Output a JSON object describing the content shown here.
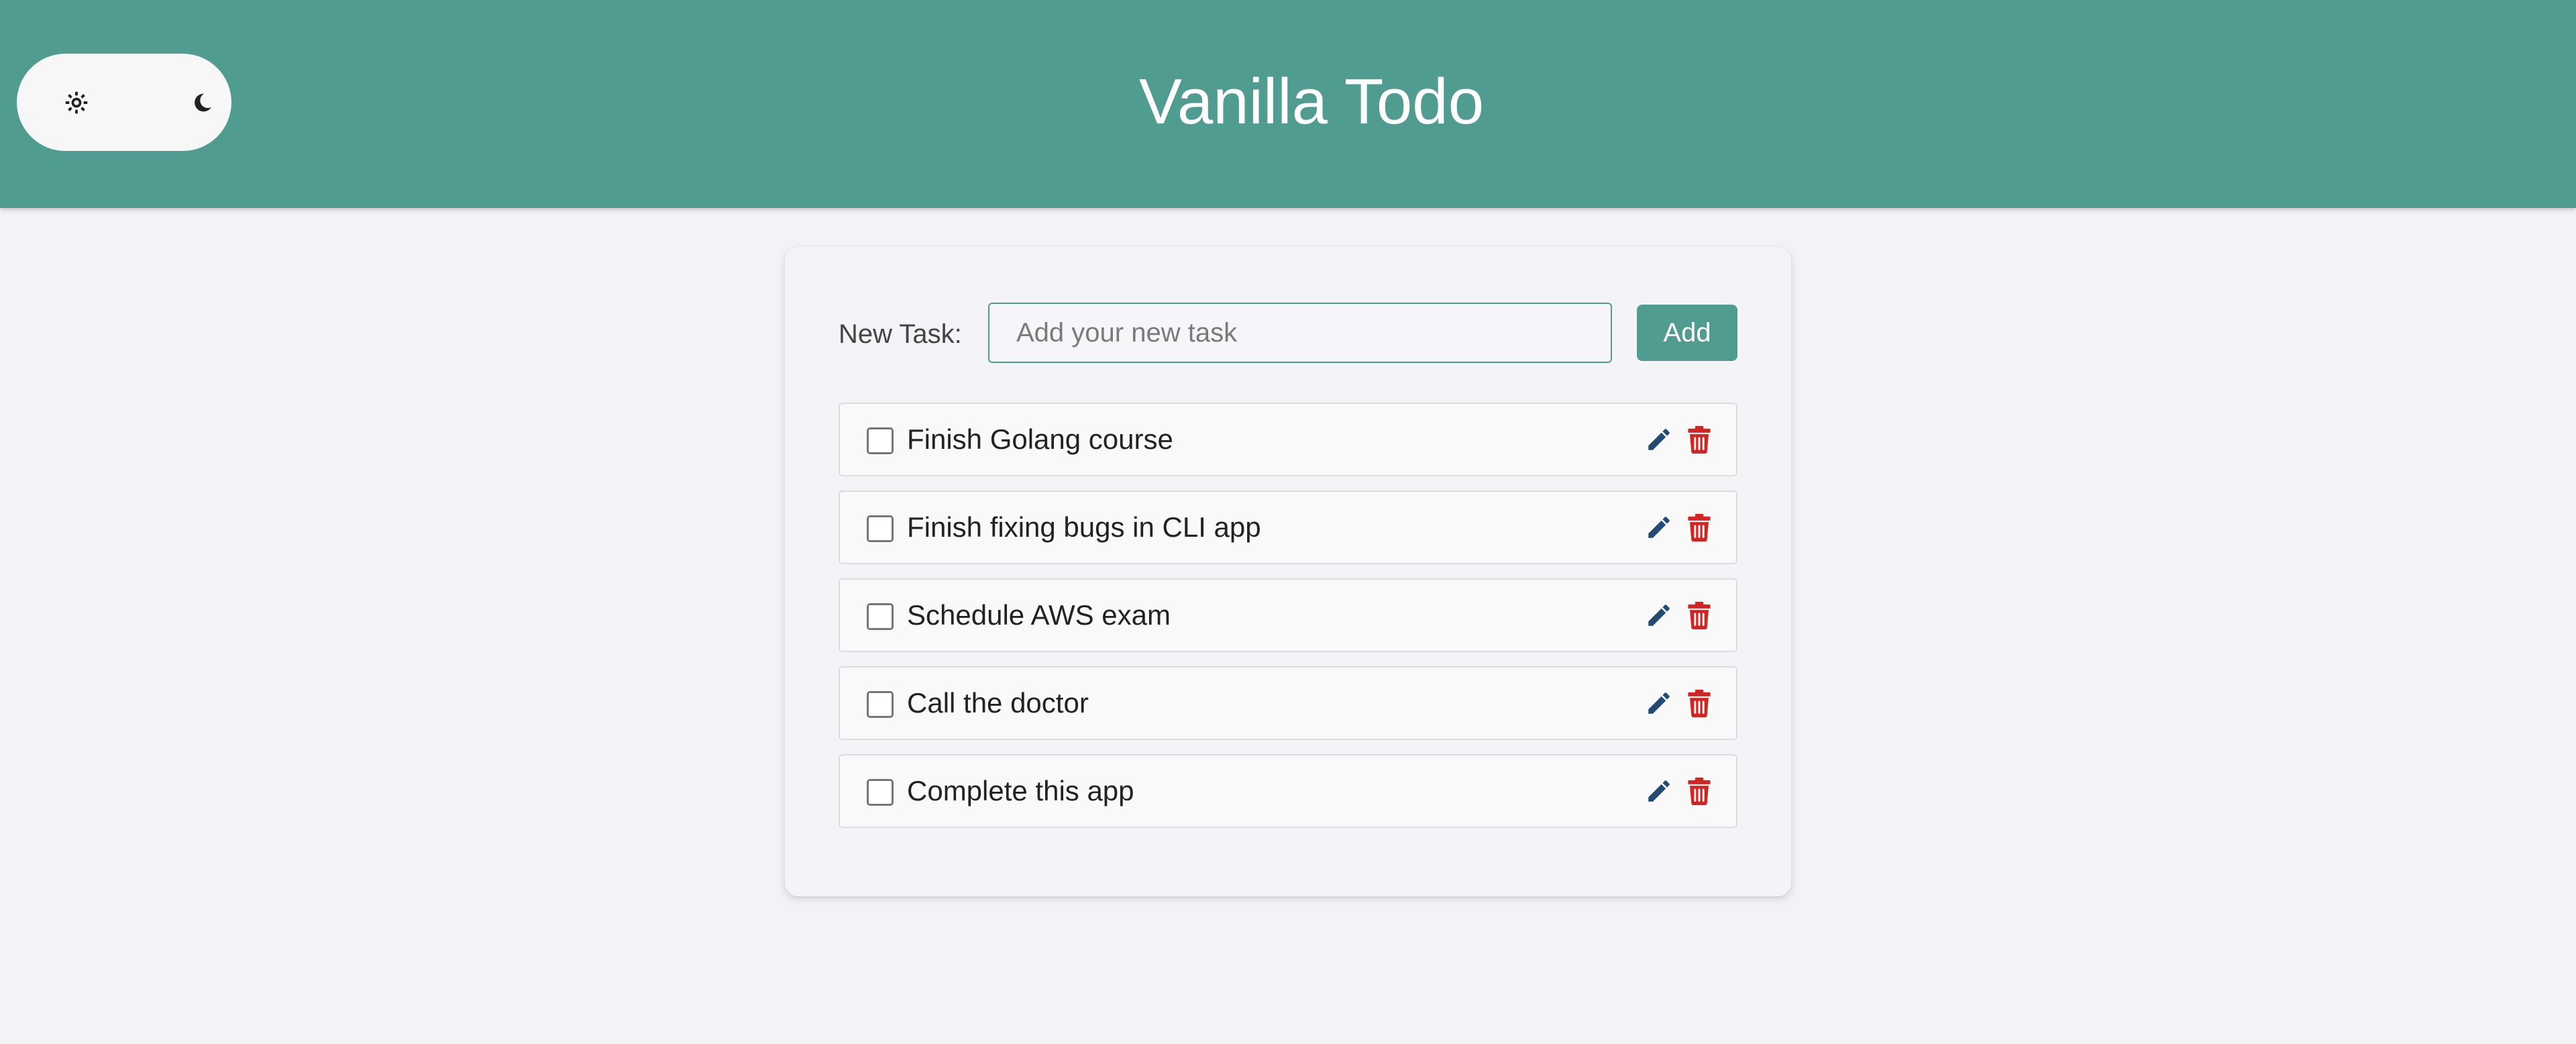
{
  "header": {
    "title": "Vanilla Todo",
    "theme_toggle": {
      "light_icon": "sun-icon",
      "dark_icon": "moon-icon"
    },
    "background_color": "#519c90"
  },
  "form": {
    "label": "New Task:",
    "input": {
      "placeholder": "Add your new task",
      "value": ""
    },
    "add_label": "Add"
  },
  "tasks": [
    {
      "text": "Finish Golang course",
      "done": false
    },
    {
      "text": "Finish fixing bugs in CLI app",
      "done": false
    },
    {
      "text": "Schedule AWS exam",
      "done": false
    },
    {
      "text": "Call the doctor",
      "done": false
    },
    {
      "text": "Complete this app",
      "done": false
    }
  ],
  "icons": {
    "edit": "pencil-icon",
    "delete": "trash-icon"
  },
  "colors": {
    "accent": "#519c90",
    "edit": "#234a72",
    "delete": "#d32424"
  }
}
